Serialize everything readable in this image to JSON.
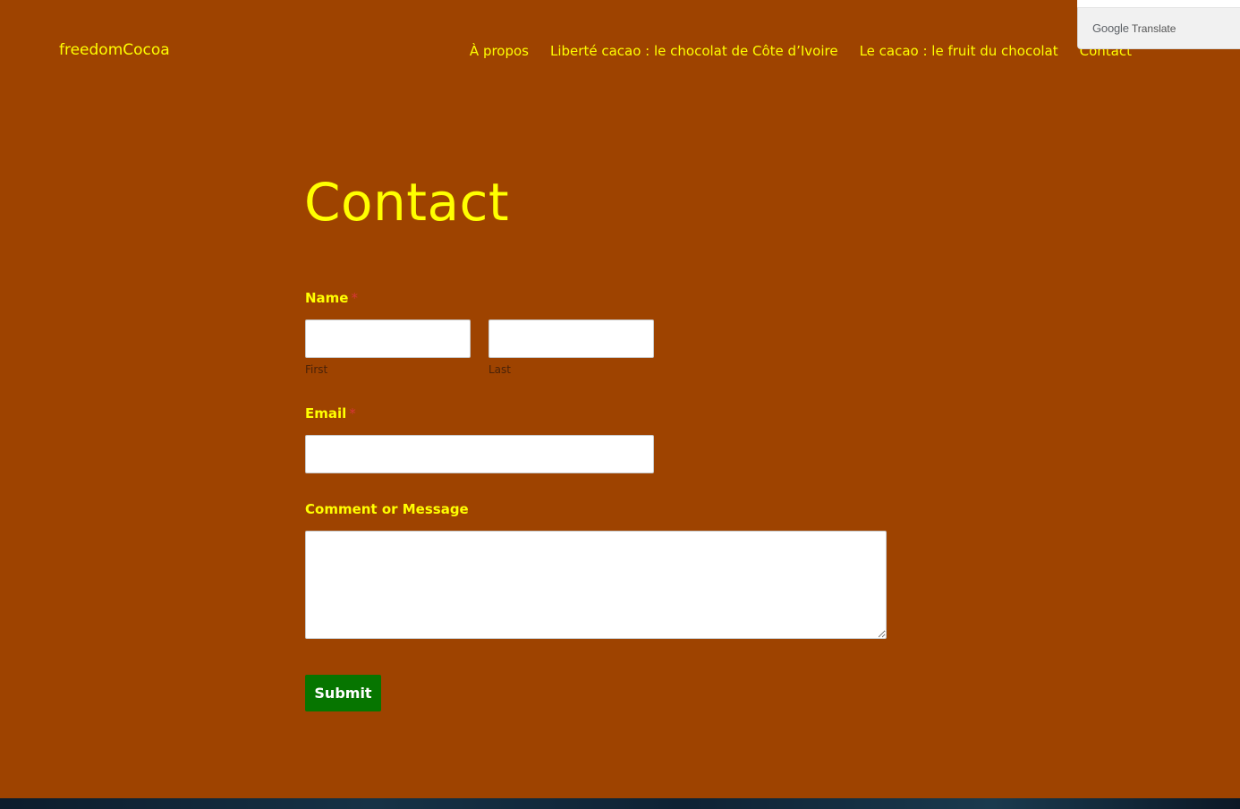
{
  "site": {
    "title": "freedomCocoa"
  },
  "nav": {
    "items": [
      {
        "label": "À propos"
      },
      {
        "label": "Liberté cacao : le chocolat de Côte d’Ivoire"
      },
      {
        "label": "Le cacao : le fruit du chocolat"
      },
      {
        "label": "Contact"
      }
    ]
  },
  "translate": {
    "brand": "Google",
    "label": "Translate"
  },
  "main": {
    "title": "Contact"
  },
  "form": {
    "name": {
      "label": "Name",
      "required_mark": "*",
      "first_value": "",
      "last_value": "",
      "first_sublabel": "First",
      "last_sublabel": "Last"
    },
    "email": {
      "label": "Email",
      "required_mark": "*",
      "value": ""
    },
    "message": {
      "label": "Comment or Message",
      "value": ""
    },
    "submit_label": "Submit"
  },
  "colors": {
    "background": "#9e4300",
    "accent_text": "#ffff00",
    "submit_button": "#067500",
    "required": "#d63638"
  }
}
